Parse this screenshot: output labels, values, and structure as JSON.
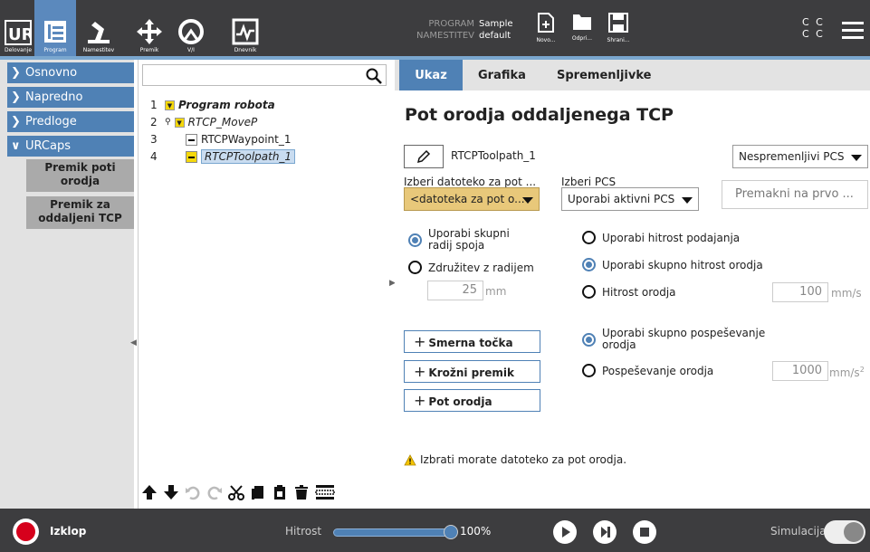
{
  "topbar": {
    "tabs": [
      {
        "label": "Delovanje"
      },
      {
        "label": "Program"
      },
      {
        "label": "Namestitev"
      },
      {
        "label": "Premik"
      },
      {
        "label": "V/I"
      },
      {
        "label": "Dnevnik"
      }
    ],
    "program_key": "PROGRAM",
    "program_value": "Sample",
    "install_key": "NAMESTITEV",
    "install_value": "default",
    "file_new": "Novo...",
    "file_open": "Odpri...",
    "file_save": "Shrani...",
    "cc_line1": "C C",
    "cc_line2": "C C"
  },
  "sidebar": {
    "items": [
      {
        "label": "Osnovno"
      },
      {
        "label": "Napredno"
      },
      {
        "label": "Predloge"
      },
      {
        "label": "URCaps"
      }
    ],
    "subitems": [
      {
        "label": "Premik poti orodja"
      },
      {
        "label": "Premik za oddaljeni TCP"
      }
    ]
  },
  "tree": {
    "rows": [
      {
        "num": "1",
        "label": "Program robota"
      },
      {
        "num": "2",
        "label": "RTCP_MoveP"
      },
      {
        "num": "3",
        "label": "RTCPWaypoint_1"
      },
      {
        "num": "4",
        "label": "RTCPToolpath_1"
      }
    ]
  },
  "tabs": {
    "ukaz": "Ukaz",
    "grafika": "Grafika",
    "spremenljivke": "Spremenljivke"
  },
  "main": {
    "title": "Pot orodja oddaljenega TCP",
    "name_value": "RTCPToolpath_1",
    "pcs_fixed": "Nespremenljivi PCS",
    "file_label": "Izberi datoteko za pot ...",
    "file_value": "<datoteka za pot o...",
    "pcs_label": "Izberi PCS",
    "pcs_value": "Uporabi aktivni PCS",
    "move_first": "Premakni na prvo ...",
    "radio_blend_shared": "Uporabi skupni radij spoja",
    "radio_blend": "Združitev z radijem",
    "blend_value": "25",
    "blend_unit": "mm",
    "radio_feed": "Uporabi hitrost podajanja",
    "radio_shared_speed": "Uporabi skupno hitrost orodja",
    "radio_speed": "Hitrost orodja",
    "speed_value": "100",
    "speed_unit": "mm/s",
    "btn_waypoint": "Smerna točka",
    "btn_circ": "Krožni premik",
    "btn_path": "Pot orodja",
    "radio_shared_acc": "Uporabi skupno pospeševanje orodja",
    "radio_acc": "Pospeševanje orodja",
    "acc_value": "1000",
    "acc_unit": "mm/s",
    "acc_exp": "2",
    "warning": "Izbrati morate datoteko za pot orodja."
  },
  "bottombar": {
    "status": "Izklop",
    "speed_label": "Hitrost",
    "speed_pct": "100%",
    "speed_level": 1.0,
    "sim_label": "Simulacija"
  },
  "colors": {
    "accent": "#4f81b5",
    "topbar": "#3d3d3f",
    "warning_field": "#e8c87a",
    "flag": "#f5d80b"
  }
}
